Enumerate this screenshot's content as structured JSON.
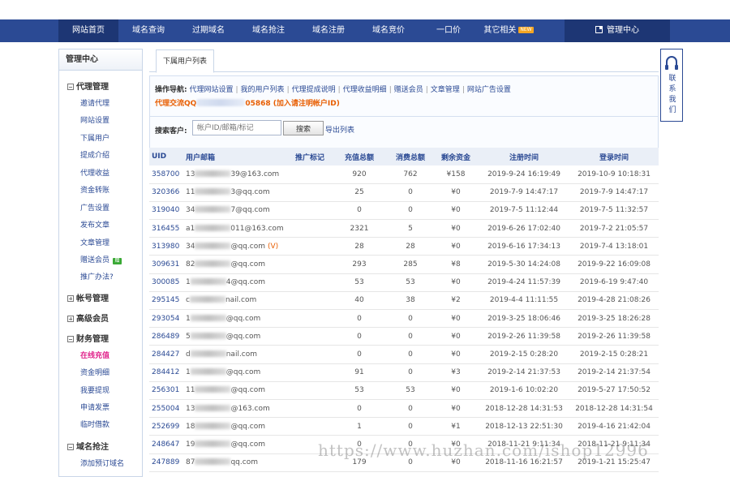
{
  "nav": {
    "items": [
      {
        "label": "网站首页",
        "active": true
      },
      {
        "label": "域名查询"
      },
      {
        "label": "过期域名"
      },
      {
        "label": "域名抢注"
      },
      {
        "label": "域名注册"
      },
      {
        "label": "域名竞价"
      },
      {
        "label": "一口价"
      },
      {
        "label": "其它相关",
        "badge": "NEW"
      }
    ],
    "admin_label": "管理中心"
  },
  "sidebar": {
    "title": "管理中心",
    "sections": [
      {
        "label": "代理管理",
        "expanded": true,
        "items": [
          "邀请代理",
          "网站设置",
          "下属用户",
          "提成介绍",
          "代理收益",
          "资金转账",
          "广告设置",
          "发布文章",
          "文章管理",
          "赠送会员",
          "推广办法?"
        ],
        "gift_badge": "赠"
      },
      {
        "label": "帐号管理",
        "expanded": false,
        "items": []
      },
      {
        "label": "高级会员",
        "expanded": false,
        "items": []
      },
      {
        "label": "财务管理",
        "expanded": true,
        "items": [
          "在线充值",
          "资金明细",
          "我要提现",
          "申请发票",
          "临时借款"
        ]
      },
      {
        "label": "域名抢注",
        "expanded": true,
        "items": [
          "添加预订域名"
        ]
      }
    ]
  },
  "main": {
    "tab": "下属用户列表",
    "opnav": {
      "label": "操作导航:",
      "links": [
        "代理网站设置",
        "我的用户列表",
        "代理提成说明",
        "代理收益明细",
        "赠送会员",
        "文章管理",
        "网站广告设置"
      ]
    },
    "qq": {
      "prefix": "代理交流QQ",
      "suffix": "05868 (加入请注明帐户ID)"
    },
    "search": {
      "label": "搜索客户:",
      "placeholder": "帐户ID/邮箱/标记",
      "button": "搜索",
      "export": "导出列表"
    }
  },
  "table": {
    "headers": [
      "UID",
      "用户邮箱",
      "推广标记",
      "充值总额",
      "消费总额",
      "剩余资金",
      "注册时间",
      "登录时间"
    ],
    "rows": [
      {
        "uid": "358700",
        "email_pre": "13",
        "email_post": "39@163.com",
        "vip": "",
        "recharge": "920",
        "spend": "762",
        "balance": "¥158",
        "reg": "2019-9-24 16:19:49",
        "login": "2019-10-9 10:18:31"
      },
      {
        "uid": "320366",
        "email_pre": "11",
        "email_post": "3@qq.com",
        "vip": "",
        "recharge": "25",
        "spend": "0",
        "balance": "¥0",
        "reg": "2019-7-9 14:47:17",
        "login": "2019-7-9 14:47:17"
      },
      {
        "uid": "319040",
        "email_pre": "34",
        "email_post": "7@qq.com",
        "vip": "",
        "recharge": "0",
        "spend": "0",
        "balance": "¥0",
        "reg": "2019-7-5 11:12:44",
        "login": "2019-7-5 11:32:57"
      },
      {
        "uid": "316455",
        "email_pre": "a1",
        "email_post": "011@163.com",
        "vip": "",
        "recharge": "2321",
        "spend": "5",
        "balance": "¥0",
        "reg": "2019-6-26 17:02:40",
        "login": "2019-7-2 21:05:57"
      },
      {
        "uid": "313980",
        "email_pre": "34",
        "email_post": "@qq.com",
        "vip": "(V)",
        "recharge": "28",
        "spend": "28",
        "balance": "¥0",
        "reg": "2019-6-16 17:34:13",
        "login": "2019-7-4 13:18:01"
      },
      {
        "uid": "309631",
        "email_pre": "82",
        "email_post": "@qq.com",
        "vip": "",
        "recharge": "293",
        "spend": "285",
        "balance": "¥8",
        "reg": "2019-5-30 14:24:08",
        "login": "2019-9-22 16:09:08"
      },
      {
        "uid": "300085",
        "email_pre": "1",
        "email_post": "4@qq.com",
        "vip": "",
        "recharge": "53",
        "spend": "53",
        "balance": "¥0",
        "reg": "2019-4-24 11:57:39",
        "login": "2019-6-19 9:47:40"
      },
      {
        "uid": "295145",
        "email_pre": "c",
        "email_post": "nail.com",
        "vip": "",
        "recharge": "40",
        "spend": "38",
        "balance": "¥2",
        "reg": "2019-4-4 11:11:55",
        "login": "2019-4-28 21:08:26"
      },
      {
        "uid": "293054",
        "email_pre": "1",
        "email_post": "@qq.com",
        "vip": "",
        "recharge": "0",
        "spend": "0",
        "balance": "¥0",
        "reg": "2019-3-25 18:06:46",
        "login": "2019-3-25 18:26:28"
      },
      {
        "uid": "286489",
        "email_pre": "5",
        "email_post": "@qq.com",
        "vip": "",
        "recharge": "0",
        "spend": "0",
        "balance": "¥0",
        "reg": "2019-2-26 11:39:58",
        "login": "2019-2-26 11:39:58"
      },
      {
        "uid": "284427",
        "email_pre": "d",
        "email_post": "nail.com",
        "vip": "",
        "recharge": "0",
        "spend": "0",
        "balance": "¥0",
        "reg": "2019-2-15 0:28:20",
        "login": "2019-2-15 0:28:21"
      },
      {
        "uid": "284412",
        "email_pre": "1",
        "email_post": "@qq.com",
        "vip": "",
        "recharge": "91",
        "spend": "0",
        "balance": "¥3",
        "reg": "2019-2-14 21:37:53",
        "login": "2019-2-14 21:37:54"
      },
      {
        "uid": "256301",
        "email_pre": "11",
        "email_post": "@qq.com",
        "vip": "",
        "recharge": "53",
        "spend": "53",
        "balance": "¥0",
        "reg": "2019-1-6 10:02:20",
        "login": "2019-5-27 17:50:52"
      },
      {
        "uid": "255004",
        "email_pre": "13",
        "email_post": "@163.com",
        "vip": "",
        "recharge": "0",
        "spend": "0",
        "balance": "¥0",
        "reg": "2018-12-28 14:31:53",
        "login": "2018-12-28 14:31:54"
      },
      {
        "uid": "252699",
        "email_pre": "18",
        "email_post": "@qq.com",
        "vip": "",
        "recharge": "1",
        "spend": "0",
        "balance": "¥1",
        "reg": "2018-12-13 22:51:30",
        "login": "2019-4-16 21:42:04"
      },
      {
        "uid": "248647",
        "email_pre": "19",
        "email_post": "@qq.com",
        "vip": "",
        "recharge": "0",
        "spend": "0",
        "balance": "¥0",
        "reg": "2018-11-21 9:11:34",
        "login": "2018-11-21 9:11:34"
      },
      {
        "uid": "247889",
        "email_pre": "87",
        "email_post": "qq.com",
        "vip": "",
        "recharge": "179",
        "spend": "0",
        "balance": "¥0",
        "reg": "2018-11-16 16:21:57",
        "login": "2019-1-21 15:25:47"
      }
    ]
  },
  "contact": {
    "text": "联系我们"
  },
  "watermark": "https://www.huzhan.com/ishop12996",
  "colors": {
    "nav": "#2b4a94",
    "nav_active": "#1d3674",
    "link": "#2b4a94",
    "hot": "#e0218a",
    "qq": "#e85d00"
  }
}
